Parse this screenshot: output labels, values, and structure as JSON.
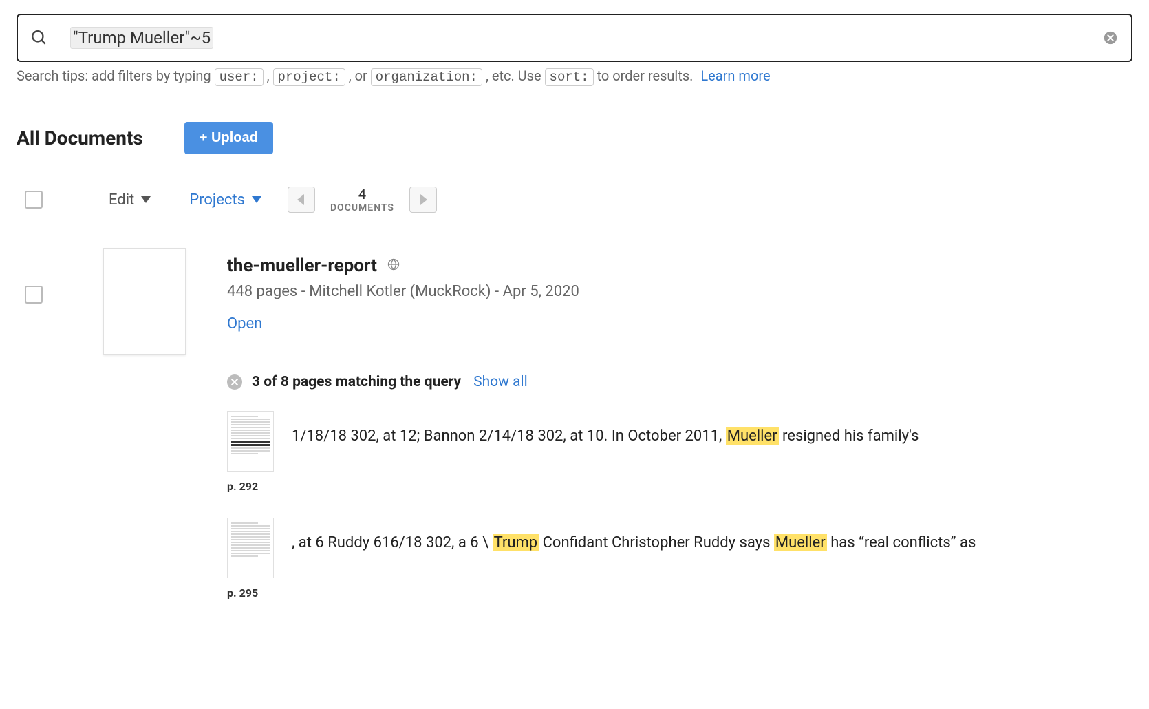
{
  "search": {
    "query": "\"Trump Mueller\"~5"
  },
  "tips": {
    "prefix": "Search tips: add filters by typing ",
    "filter1": "user:",
    "sep1": ", ",
    "filter2": "project:",
    "sep2": ", or ",
    "filter3": "organization:",
    "sep3": ", etc. Use ",
    "filter4": "sort:",
    "suffix": " to order results. ",
    "learn_more": "Learn more"
  },
  "header": {
    "title": "All Documents",
    "upload_label": "+ Upload"
  },
  "toolbar": {
    "edit_label": "Edit",
    "projects_label": "Projects",
    "count": "4",
    "count_label": "DOCUMENTS"
  },
  "result": {
    "title": "the-mueller-report",
    "subtitle": "448 pages - Mitchell Kotler (MuckRock) - Apr 5, 2020",
    "open_label": "Open",
    "match_summary": "3 of 8 pages matching the query",
    "show_all_label": "Show all",
    "snippets": [
      {
        "page": "p. 292",
        "pre": "1/18/18 302, at 12; Bannon 2/14/18 302, at 10. In October 2011, ",
        "hl1": "Mueller",
        "mid": " resigned his family's",
        "hl2": "",
        "post": ""
      },
      {
        "page": "p. 295",
        "pre": ", at 6 Ruddy 616/18 302, a 6 \\ ",
        "hl1": "Trump",
        "mid": " Confidant Christopher Ruddy says ",
        "hl2": "Mueller",
        "post": " has “real conflicts” as"
      }
    ]
  }
}
